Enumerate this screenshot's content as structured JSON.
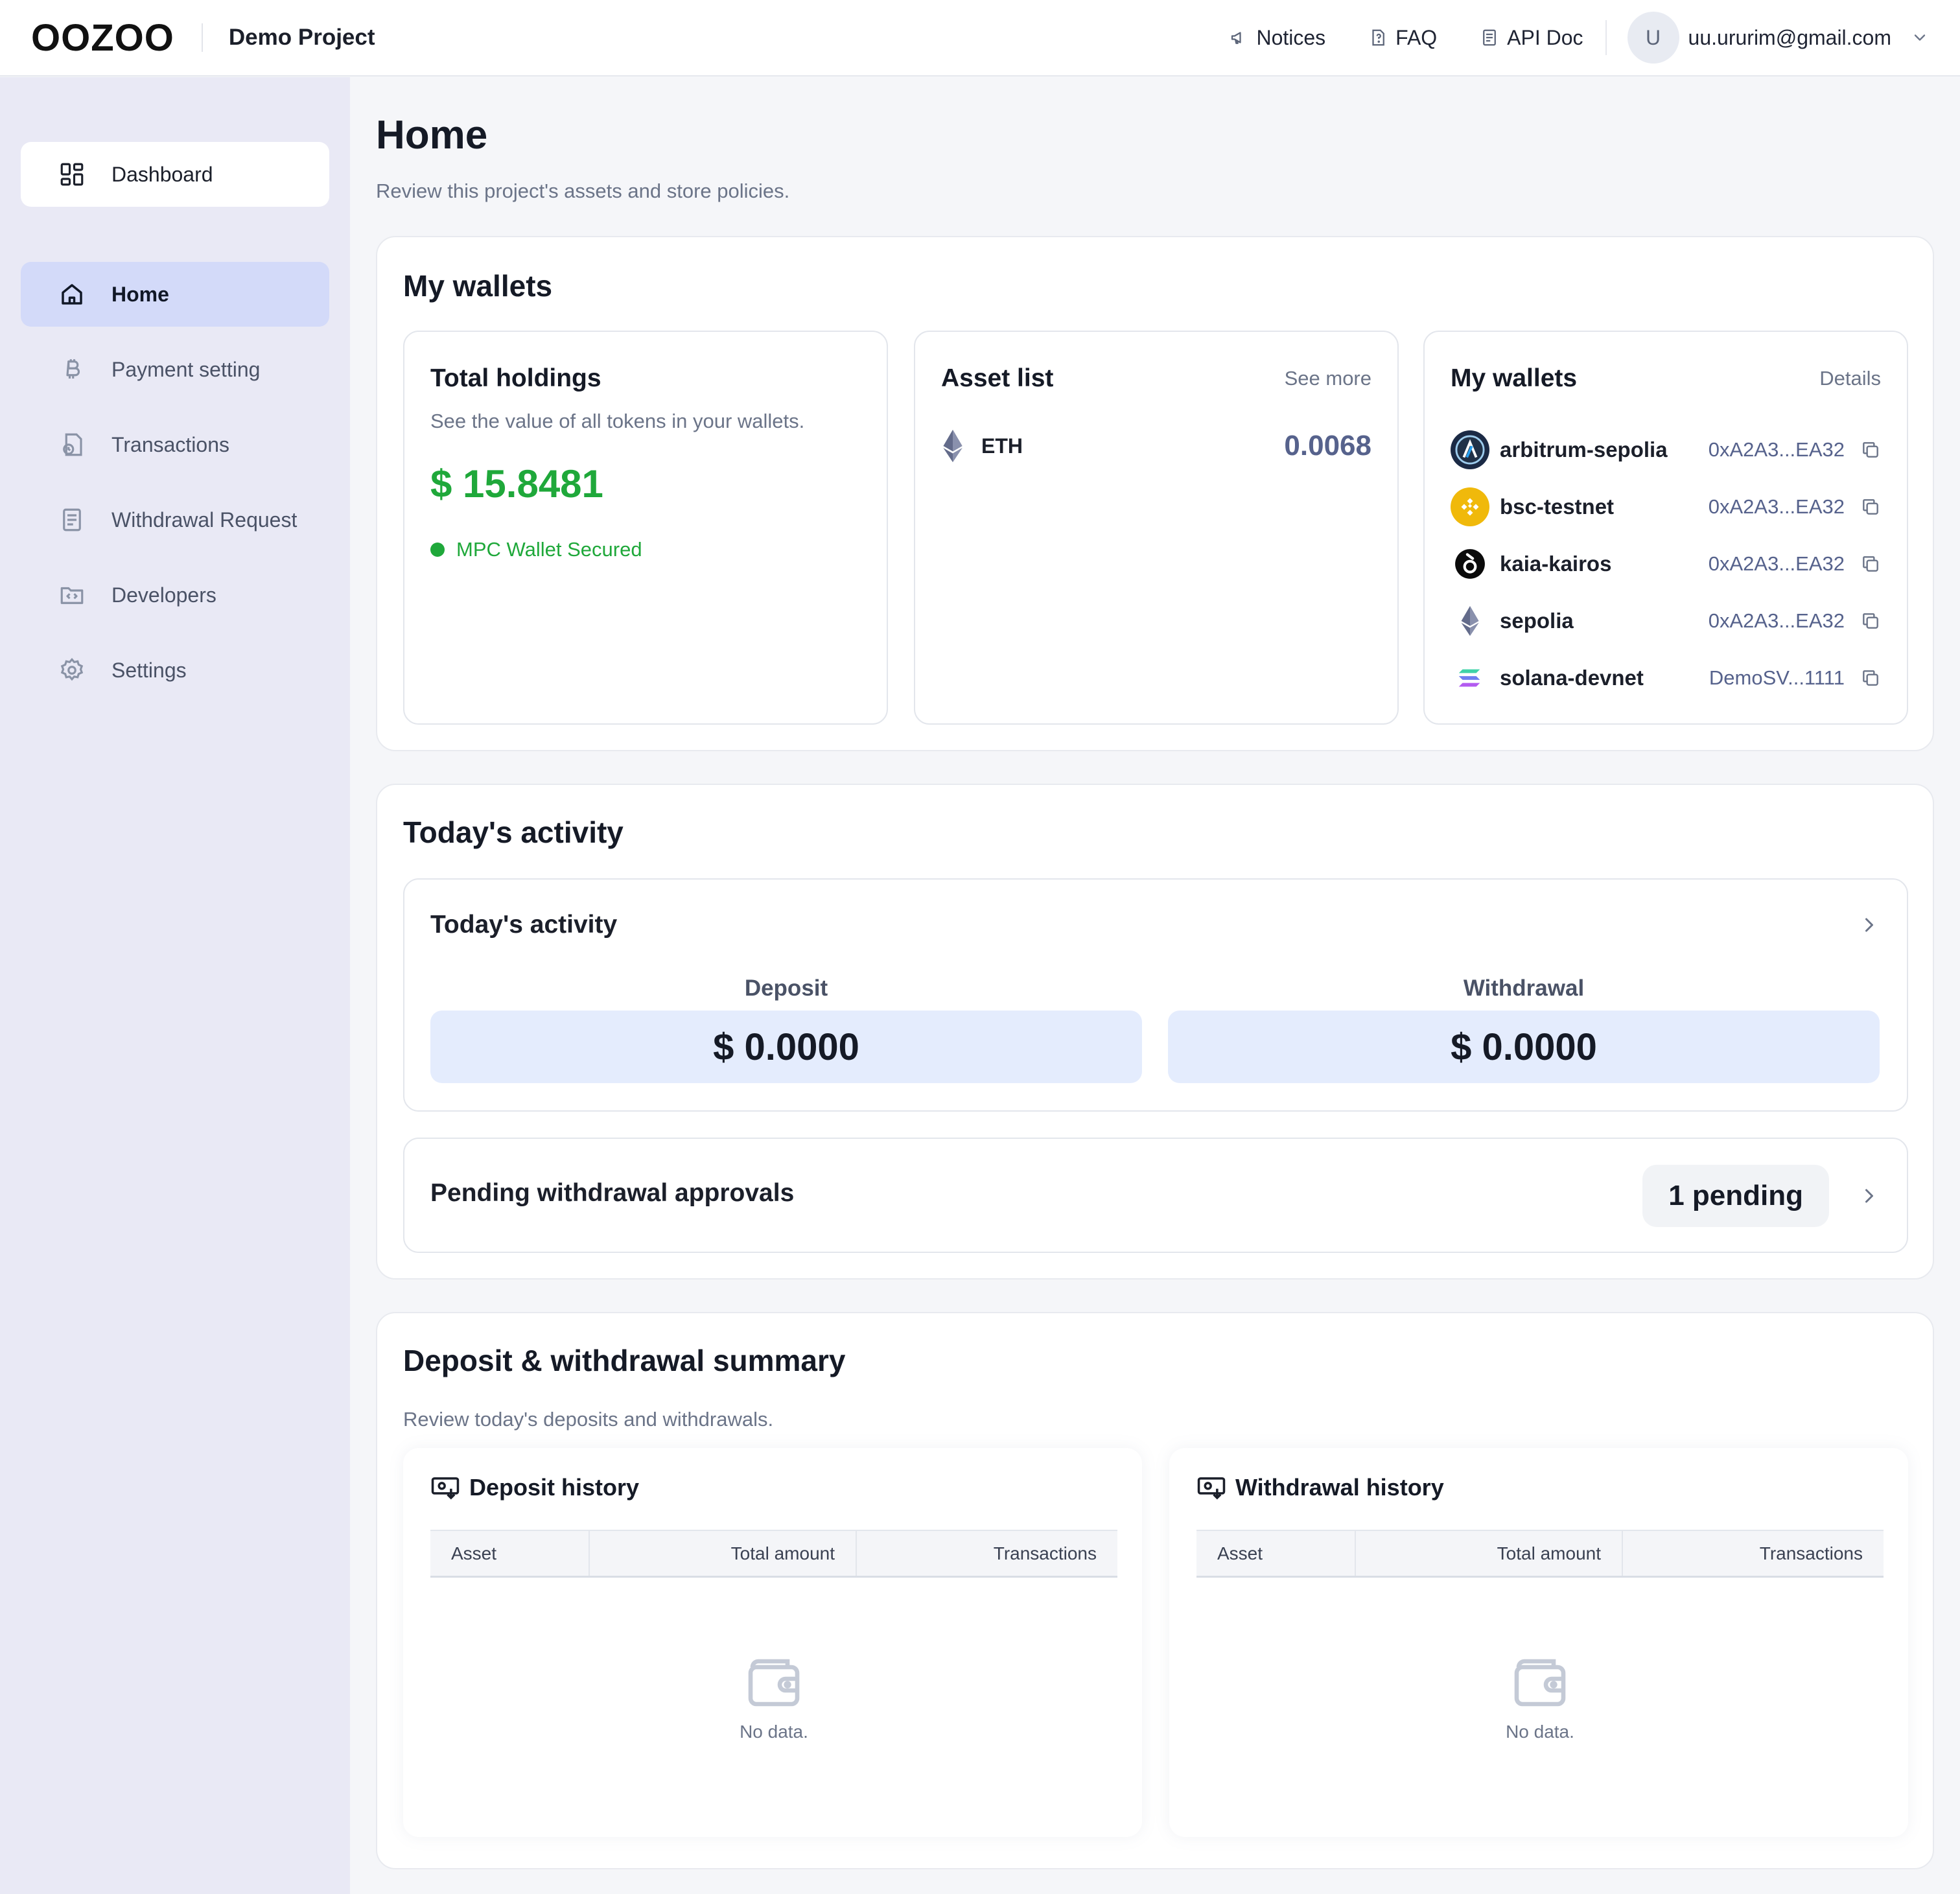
{
  "header": {
    "logo": "OOZOO",
    "project": "Demo Project",
    "links": {
      "notices": "Notices",
      "faq": "FAQ",
      "api_doc": "API Doc"
    },
    "avatar_initial": "U",
    "email": "uu.ururim@gmail.com"
  },
  "sidebar": {
    "dashboard": "Dashboard",
    "items": [
      {
        "label": "Home",
        "icon": "home-icon",
        "active": true
      },
      {
        "label": "Payment setting",
        "icon": "bitcoin-icon"
      },
      {
        "label": "Transactions",
        "icon": "transactions-icon"
      },
      {
        "label": "Withdrawal Request",
        "icon": "document-icon"
      },
      {
        "label": "Developers",
        "icon": "code-folder-icon"
      },
      {
        "label": "Settings",
        "icon": "gear-icon"
      }
    ]
  },
  "page": {
    "title": "Home",
    "subtitle": "Review this project's assets and store policies."
  },
  "wallets_section": {
    "title": "My wallets",
    "total_holdings": {
      "title": "Total holdings",
      "subtitle": "See the value of all tokens in your wallets.",
      "value": "$ 15.8481",
      "status": "MPC Wallet Secured"
    },
    "asset_list": {
      "title": "Asset list",
      "link": "See more",
      "assets": [
        {
          "symbol": "ETH",
          "amount": "0.0068",
          "icon": "ethereum-icon"
        }
      ]
    },
    "my_wallets": {
      "title": "My wallets",
      "link": "Details",
      "wallets": [
        {
          "chain": "arbitrum-sepolia",
          "address": "0xA2A3...EA32",
          "icon": "arbitrum-icon"
        },
        {
          "chain": "bsc-testnet",
          "address": "0xA2A3...EA32",
          "icon": "bnb-icon"
        },
        {
          "chain": "kaia-kairos",
          "address": "0xA2A3...EA32",
          "icon": "kaia-icon"
        },
        {
          "chain": "sepolia",
          "address": "0xA2A3...EA32",
          "icon": "ethereum-icon"
        },
        {
          "chain": "solana-devnet",
          "address": "DemoSV...1111",
          "icon": "solana-icon"
        }
      ]
    }
  },
  "activity_section": {
    "title": "Today's activity",
    "card_title": "Today's activity",
    "deposit_label": "Deposit",
    "deposit_value": "$ 0.0000",
    "withdrawal_label": "Withdrawal",
    "withdrawal_value": "$ 0.0000",
    "pending_label": "Pending withdrawal approvals",
    "pending_count": "1 pending"
  },
  "summary_section": {
    "title": "Deposit & withdrawal summary",
    "subtitle": "Review today's deposits and withdrawals.",
    "deposit_history": {
      "title": "Deposit history",
      "columns": [
        "Asset",
        "Total amount",
        "Transactions"
      ],
      "empty": "No data."
    },
    "withdrawal_history": {
      "title": "Withdrawal history",
      "columns": [
        "Asset",
        "Total amount",
        "Transactions"
      ],
      "empty": "No data."
    }
  },
  "colors": {
    "accent": "#d3daf9",
    "positive": "#1fa83a",
    "sidebar_bg": "#e9e9f5",
    "activity_box": "#e4ecfd"
  }
}
